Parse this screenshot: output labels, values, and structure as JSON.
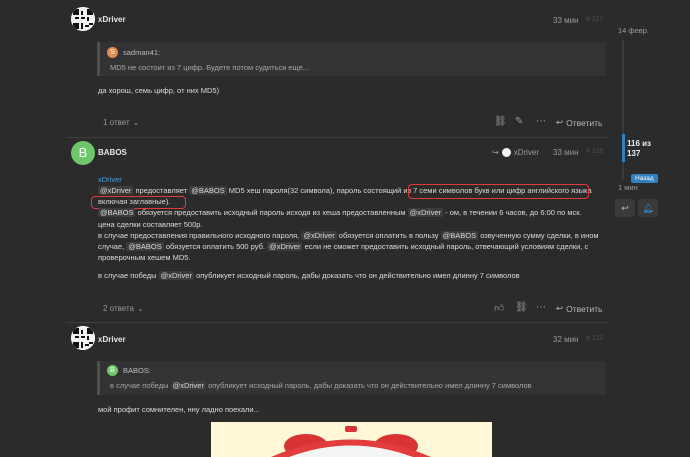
{
  "posts": [
    {
      "username": "xDriver",
      "time": "33 мин",
      "post_no": "# 117",
      "quote": {
        "author": "sadman41:",
        "avatar_letter": "S",
        "avatar_color": "#e08a50",
        "text": "MD5 не состоит из 7 цифр. Будете потом судиться еще..."
      },
      "body": "да хорош, семь цифр, от них MD5)",
      "replies": "1 ответ",
      "reply_label": "Ответить"
    },
    {
      "username": "BABOS",
      "avatar_letter": "B",
      "reply_to": "xDriver",
      "time": "33 мин",
      "post_no": "# 118",
      "mention_top": "xDriver",
      "lines": {
        "l1_m1": "@xDriver",
        "l1_t1": "предоставляет",
        "l1_m2": "@BABOS",
        "l1_t2": "MD5 хеш пароля(32 символа), пароль состоящий из 7",
        "l1_t3": "семи символов букв или цифр английского языка",
        "l2_t1": "включая заглавные).",
        "l3_m1": "@BABOS",
        "l3_t1": "обязуется предоставить исходный пароль исходя из хеша предоставленным",
        "l3_m2": "@xDriver",
        "l3_t2": "- ом, в течении 6 часов, до 6:00 по мск.",
        "l4": "цена сделки составляет 500р.",
        "l5_t1": "в случае предоставления правильного исходного пароля,",
        "l5_m1": "@xDriver",
        "l5_t2": "обязуется оплатить в пользу",
        "l5_m2": "@BABOS",
        "l5_t3": "озвученную сумму сделки, в ином",
        "l6_t1": "случае,",
        "l6_m1": "@BABOS",
        "l6_t2": "обязуется оплатить 500 руб.",
        "l6_m2": "@xDriver",
        "l6_t3": "если не сможет предоставить исходный пароль, отвечающий условиям сделки, с",
        "l7": "проверочным хешем MD5.",
        "l8_t1": "в случае победы",
        "l8_m1": "@xDriver",
        "l8_t2": "опубликует исходный пароль, дабы доказать что он действительно имел длинну 7 символов"
      },
      "replies": "2 ответа",
      "reply_label": "Ответить"
    },
    {
      "username": "xDriver",
      "time": "32 мин",
      "post_no": "# 119",
      "quote": {
        "author": "BABOS:",
        "avatar_letter": "B",
        "avatar_color": "#6ec76a",
        "t1": "в случае победы",
        "m1": "@xDriver",
        "t2": "опубликует исходный пароль, дабы доказать что он действительно имел длинну 7 символов"
      },
      "body": "мой профит сомнителен, нну ладно поехали..."
    }
  ],
  "timeline": {
    "date": "14 февр.",
    "position": "116 из 137",
    "ago": "1 мин",
    "back": "Назад"
  },
  "colors": {
    "accent": "#2f7fc1",
    "highlight": "#e23a3a",
    "bg": "#2b2b2b"
  }
}
